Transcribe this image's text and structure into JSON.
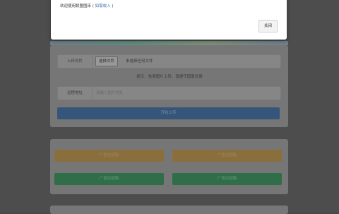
{
  "modal": {
    "message": "欢迎使用联盟图床 ( ",
    "link": "如需收入",
    "message_end": " )",
    "close_label": "关闭"
  },
  "upload": {
    "file_label": "上传文件",
    "choose_button": "选择文件",
    "file_status": "未选择任何文件",
    "hint": "提示：免费图片上传，请遵守国家法律",
    "url_label": "远程地址",
    "url_placeholder": "请输入图片地址",
    "submit_label": "开始上传"
  },
  "ads": {
    "buttons": [
      {
        "label": "广告位招租",
        "color": "orange"
      },
      {
        "label": "广告位招租",
        "color": "orange"
      },
      {
        "label": "广告位招租",
        "color": "green"
      },
      {
        "label": "广告位招租",
        "color": "green"
      }
    ]
  }
}
